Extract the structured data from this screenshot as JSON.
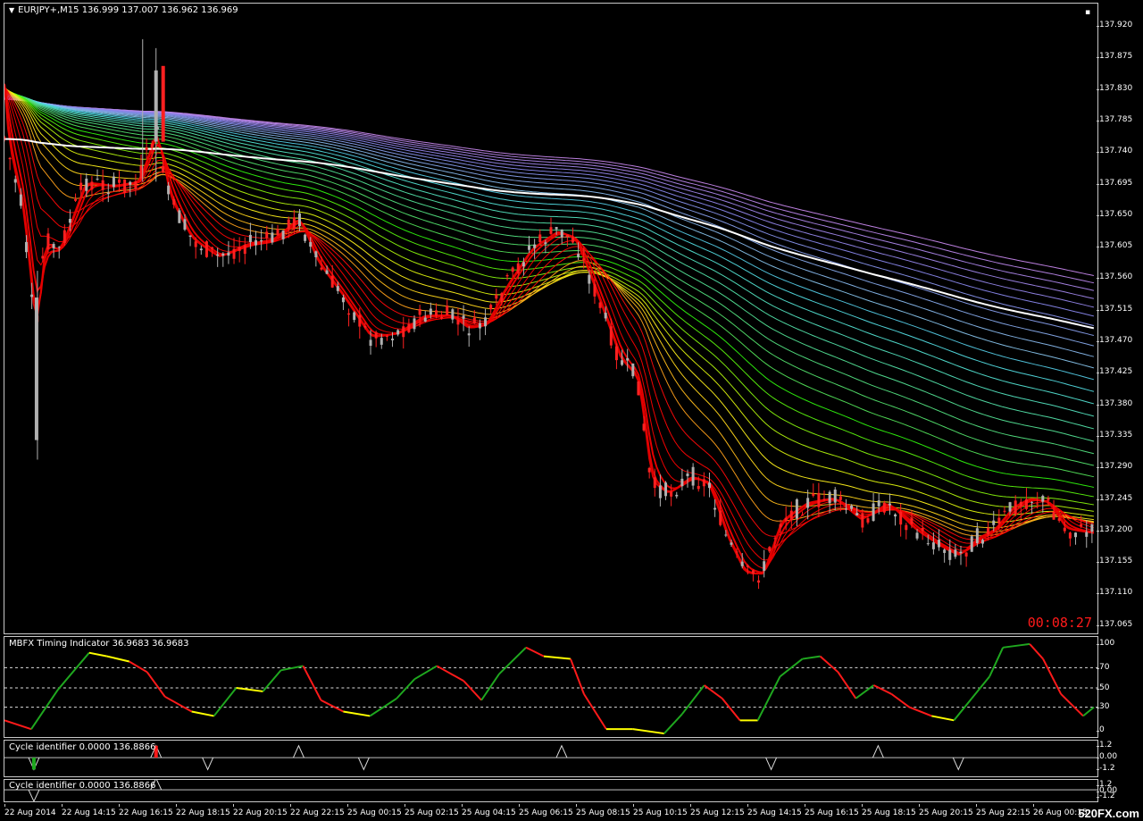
{
  "main": {
    "title": "EURJPY+,M15  136.999 137.007 136.962 136.969",
    "timer": "00:08:27",
    "price_ticks": [
      "137.920",
      "137.875",
      "137.830",
      "137.785",
      "137.740",
      "137.695",
      "137.650",
      "137.605",
      "137.560",
      "137.515",
      "137.470",
      "137.425",
      "137.380",
      "137.335",
      "137.290",
      "137.245",
      "137.200",
      "137.155",
      "137.110",
      "137.065"
    ]
  },
  "mbfx": {
    "title": "MBFX Timing Indicator 36.9683 36.9683",
    "ticks": [
      "100",
      "70",
      "50",
      "30",
      "0"
    ]
  },
  "cycle1": {
    "title": "Cycle identifier 0.0000 136.8866",
    "ticks": [
      "1.2",
      "0.00",
      "-1.2"
    ]
  },
  "cycle2": {
    "title": "Cycle identifier 0.0000 136.8866",
    "ticks": [
      "1.2",
      "0.00",
      "-1.2"
    ]
  },
  "time_axis": [
    "22 Aug 2014",
    "22 Aug 14:15",
    "22 Aug 16:15",
    "22 Aug 18:15",
    "22 Aug 20:15",
    "22 Aug 22:15",
    "25 Aug 00:15",
    "25 Aug 02:15",
    "25 Aug 04:15",
    "25 Aug 06:15",
    "25 Aug 08:15",
    "25 Aug 10:15",
    "25 Aug 12:15",
    "25 Aug 14:15",
    "25 Aug 16:15",
    "25 Aug 18:15",
    "25 Aug 20:15",
    "25 Aug 22:15",
    "26 Aug 00:15"
  ],
  "watermark": "520FX.com",
  "colors": {
    "up": "#b0b0b0",
    "down": "#ff2020",
    "green": "#1fa81f",
    "yellow": "#ffff00",
    "red": "#ff1a1a",
    "white": "#ffffff"
  }
}
